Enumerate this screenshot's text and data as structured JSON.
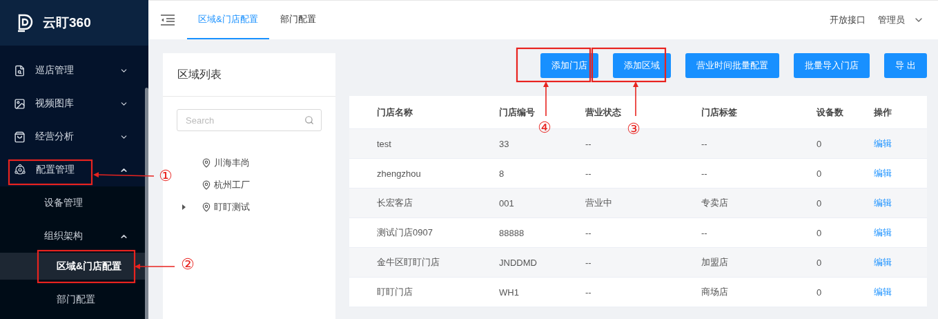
{
  "logo": {
    "text": "云盯360"
  },
  "sidebar": {
    "items": [
      {
        "label": "巡店管理",
        "expanded": false
      },
      {
        "label": "视频图库",
        "expanded": false
      },
      {
        "label": "经营分析",
        "expanded": false
      },
      {
        "label": "配置管理",
        "expanded": true,
        "children": [
          {
            "label": "设备管理",
            "selected": false
          },
          {
            "label": "组织架构",
            "expanded": true,
            "children": [
              {
                "label": "区域&门店配置",
                "selected": true
              },
              {
                "label": "部门配置",
                "selected": false
              }
            ]
          }
        ]
      }
    ]
  },
  "tabs": [
    {
      "label": "区域&门店配置",
      "selected": true
    },
    {
      "label": "部门配置",
      "selected": false
    }
  ],
  "header_links": [
    "开放接口",
    "管理员"
  ],
  "region_panel": {
    "title": "区域列表",
    "search": {
      "placeholder": "Search"
    },
    "tree": [
      {
        "label": "川海丰尚",
        "has_children": false
      },
      {
        "label": "杭州工厂",
        "has_children": false
      },
      {
        "label": "盯盯测试",
        "has_children": true
      }
    ]
  },
  "toolbar": [
    "添加门店",
    "添加区域",
    "营业时间批量配置",
    "批量导入门店",
    "导 出"
  ],
  "table": {
    "columns": [
      "门店名称",
      "门店编号",
      "营业状态",
      "门店标签",
      "设备数",
      "操作"
    ],
    "rows": [
      [
        "test",
        "33",
        "--",
        "--",
        "0",
        "编辑"
      ],
      [
        "zhengzhou",
        "8",
        "--",
        "--",
        "0",
        "编辑"
      ],
      [
        "长宏客店",
        "001",
        "营业中",
        "专卖店",
        "0",
        "编辑"
      ],
      [
        "测试门店0907",
        "88888",
        "--",
        "--",
        "0",
        "编辑"
      ],
      [
        "金牛区盯盯门店",
        "JNDDMD",
        "--",
        "加盟店",
        "0",
        "编辑"
      ],
      [
        "盯盯门店",
        "WH1",
        "--",
        "商场店",
        "0",
        "编辑"
      ]
    ]
  },
  "annotations": [
    {
      "label": "①"
    },
    {
      "label": "②"
    },
    {
      "label": "③"
    },
    {
      "label": "④"
    }
  ]
}
